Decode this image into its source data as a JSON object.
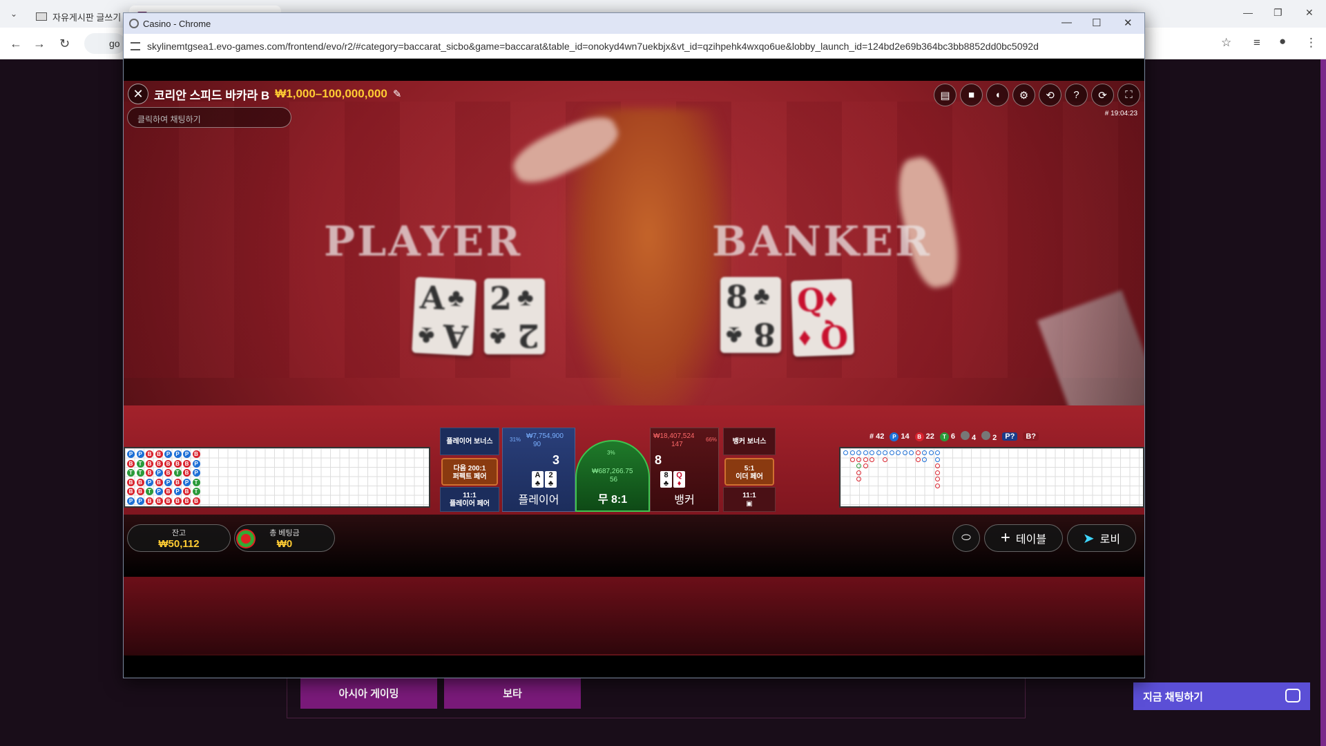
{
  "browser": {
    "tab1_title": "자유게시판 글쓰기",
    "tab2_title": "",
    "address_partial": "go"
  },
  "popup": {
    "title": "Casino - Chrome",
    "url": "skylinemtgsea1.evo-games.com/frontend/evo/r2/#category=baccarat_sicbo&game=baccarat&table_id=onokyd4wn7uekbjx&vt_id=qzihpehk4wxqo6ue&lobby_launch_id=124bd2e69b364bc3bb8852dd0bc5092d"
  },
  "game": {
    "table_name": "코리안 스피드 바카라 B",
    "limits": "₩1,000–100,000,000",
    "chat_placeholder": "클릭하여 채팅하기",
    "round_id": "# 19:04:23",
    "felt_player": "PLAYER",
    "felt_banker": "BANKER",
    "icons": [
      "chat-icon",
      "video-icon",
      "sound-icon",
      "settings-icon",
      "history-icon",
      "help-icon",
      "reload-icon",
      "fullscreen-icon"
    ]
  },
  "bets": {
    "player_bonus": "플레이어 보너스",
    "perfect_pair": [
      "퍼펙트 페어",
      "다음 200:1"
    ],
    "player_pair": [
      "11:1",
      "플레이어 페어"
    ],
    "player": {
      "label": "플레이어",
      "total": "₩7,754,900",
      "players": "90",
      "percent": "31%",
      "score": "3",
      "cards": [
        "A",
        "2"
      ]
    },
    "tie": {
      "label": "무 8:1",
      "total": "₩687,266.75",
      "players": "56",
      "percent": "3%"
    },
    "banker": {
      "label": "뱅커",
      "total": "₩18,407,524",
      "players": "147",
      "percent": "66%",
      "score": "8",
      "cards": [
        "8",
        "Q"
      ]
    },
    "banker_bonus": "뱅커 보너스",
    "either_pair": [
      "5:1",
      "이더 페어"
    ],
    "banker_pair": "11:1"
  },
  "stats": {
    "rounds": "# 42",
    "player_wins": "14",
    "banker_wins": "22",
    "ties": "6",
    "player_pairs": "4",
    "banker_pairs": "2",
    "p_next": "P?",
    "b_next": "B?"
  },
  "footer": {
    "balance_label": "잔고",
    "balance_value": "₩50,112",
    "total_bet_label": "총 베팅금",
    "total_bet_value": "₩0",
    "table_button": "테이블",
    "lobby_button": "로비"
  },
  "site": {
    "menu_asia": "아시아 게이밍",
    "menu_bota": "보타",
    "chat_now": "지금 채팅하기"
  },
  "colors": {
    "player": "#1c6fd6",
    "banker": "#d9232e",
    "tie": "#2a9a3a",
    "gold": "#ffcc33"
  }
}
